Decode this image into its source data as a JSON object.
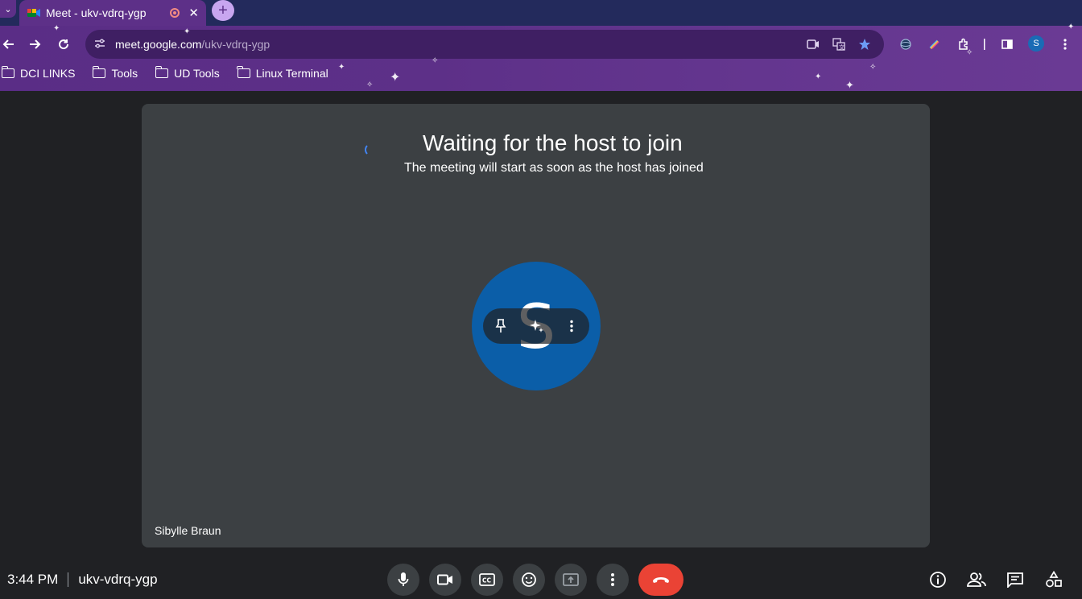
{
  "browser": {
    "tab_title": "Meet - ukv-vdrq-ygp",
    "tab_close": "✕",
    "new_tab": "+",
    "url_host": "meet.google.com",
    "url_path": "/ukv-vdrq-ygp",
    "profile_initial": "S",
    "bookmarks": [
      "DCI LINKS",
      "Tools",
      "UD Tools",
      "Linux Terminal"
    ]
  },
  "meeting": {
    "wait_title": "Waiting for the host to join",
    "wait_subtitle": "The meeting will start as soon as the host has joined",
    "participant_initial": "S",
    "participant_name": "Sibylle Braun",
    "avatar_color": "#0b5ea8"
  },
  "bottom_bar": {
    "time": "3:44 PM",
    "meeting_code": "ukv-vdrq-ygp",
    "hangup_color": "#ea4335"
  },
  "icons": [
    "reload-icon",
    "back-icon",
    "forward-icon",
    "camera-icon",
    "translate-icon",
    "star-icon",
    "extensions-icon",
    "side-panel-icon",
    "menu-icon",
    "pin-icon",
    "effects-icon",
    "more-icon",
    "microphone-icon",
    "video-icon",
    "captions-icon",
    "emoji-icon",
    "present-icon",
    "hangup-icon",
    "info-icon",
    "people-icon",
    "chat-icon",
    "activities-icon"
  ]
}
